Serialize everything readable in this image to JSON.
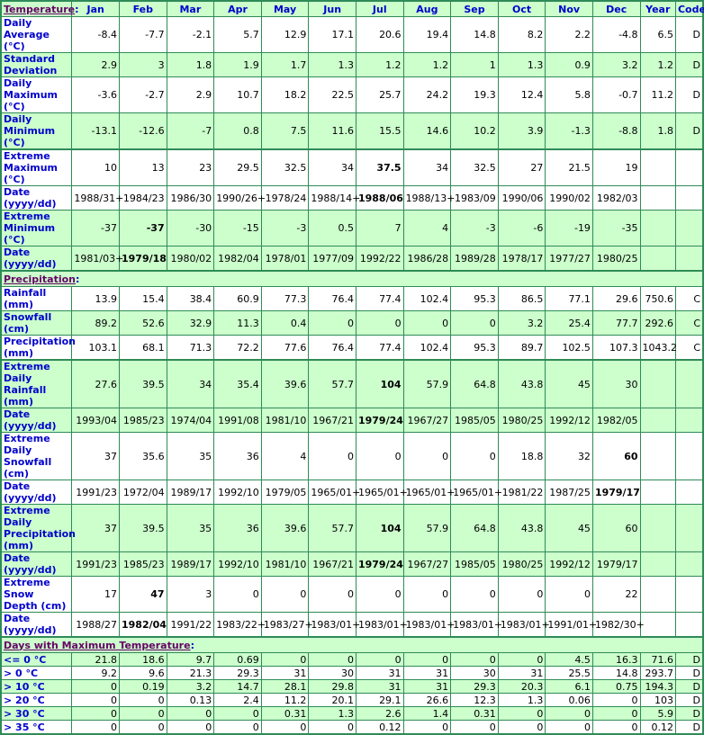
{
  "columns": [
    "Jan",
    "Feb",
    "Mar",
    "Apr",
    "May",
    "Jun",
    "Jul",
    "Aug",
    "Sep",
    "Oct",
    "Nov",
    "Dec",
    "Year",
    "Code"
  ],
  "sections": [
    {
      "title": "Temperature",
      "rows": [
        {
          "label": "Daily Average (°C)",
          "h": "h2",
          "bg": "w",
          "values": [
            "-8.4",
            "-7.7",
            "-2.1",
            "5.7",
            "12.9",
            "17.1",
            "20.6",
            "19.4",
            "14.8",
            "8.2",
            "2.2",
            "-4.8",
            "6.5",
            "D"
          ],
          "bold": []
        },
        {
          "label": "Standard Deviation",
          "h": "h2",
          "bg": "g",
          "values": [
            "2.9",
            "3",
            "1.8",
            "1.9",
            "1.7",
            "1.3",
            "1.2",
            "1.2",
            "1",
            "1.3",
            "0.9",
            "3.2",
            "1.2",
            "D"
          ],
          "bold": []
        },
        {
          "label": "Daily Maximum (°C)",
          "h": "h3",
          "bg": "w",
          "values": [
            "-3.6",
            "-2.7",
            "2.9",
            "10.7",
            "18.2",
            "22.5",
            "25.7",
            "24.2",
            "19.3",
            "12.4",
            "5.8",
            "-0.7",
            "11.2",
            "D"
          ],
          "bold": []
        },
        {
          "label": "Daily Minimum (°C)",
          "h": "h3",
          "bg": "g",
          "values": [
            "-13.1",
            "-12.6",
            "-7",
            "0.8",
            "7.5",
            "11.6",
            "15.5",
            "14.6",
            "10.2",
            "3.9",
            "-1.3",
            "-8.8",
            "1.8",
            "D"
          ],
          "bold": []
        },
        {
          "label": "Extreme Maximum (°C)",
          "h": "h3",
          "bg": "w",
          "sep": true,
          "values": [
            "10",
            "13",
            "23",
            "29.5",
            "32.5",
            "34",
            "37.5",
            "34",
            "32.5",
            "27",
            "21.5",
            "19",
            "",
            ""
          ],
          "bold": [
            6
          ]
        },
        {
          "label": "Date (yyyy/dd)",
          "h": "h2",
          "bg": "w",
          "values": [
            "1988/31+",
            "1984/23",
            "1986/30",
            "1990/26+",
            "1978/24",
            "1988/14+",
            "1988/06",
            "1988/13+",
            "1983/09",
            "1990/06",
            "1990/02",
            "1982/03",
            "",
            ""
          ],
          "bold": [
            6
          ]
        },
        {
          "label": "Extreme Minimum (°C)",
          "h": "h3",
          "bg": "g",
          "values": [
            "-37",
            "-37",
            "-30",
            "-15",
            "-3",
            "0.5",
            "7",
            "4",
            "-3",
            "-6",
            "-19",
            "-35",
            "",
            ""
          ],
          "bold": [
            1
          ]
        },
        {
          "label": "Date (yyyy/dd)",
          "h": "h2",
          "bg": "g",
          "values": [
            "1981/03+",
            "1979/18",
            "1980/02",
            "1982/04",
            "1978/01",
            "1977/09",
            "1992/22",
            "1986/28",
            "1989/28",
            "1978/17",
            "1977/27",
            "1980/25",
            "",
            ""
          ],
          "bold": [
            1
          ]
        }
      ]
    },
    {
      "title": "Precipitation",
      "rows": [
        {
          "label": "Rainfall (mm)",
          "h": "h1",
          "bg": "w",
          "values": [
            "13.9",
            "15.4",
            "38.4",
            "60.9",
            "77.3",
            "76.4",
            "77.4",
            "102.4",
            "95.3",
            "86.5",
            "77.1",
            "29.6",
            "750.6",
            "C"
          ],
          "bold": []
        },
        {
          "label": "Snowfall (cm)",
          "h": "h2",
          "bg": "g",
          "values": [
            "89.2",
            "52.6",
            "32.9",
            "11.3",
            "0.4",
            "0",
            "0",
            "0",
            "0",
            "3.2",
            "25.4",
            "77.7",
            "292.6",
            "C"
          ],
          "bold": []
        },
        {
          "label": "Precipitation (mm)",
          "h": "h2",
          "bg": "w",
          "values": [
            "103.1",
            "68.1",
            "71.3",
            "72.2",
            "77.6",
            "76.4",
            "77.4",
            "102.4",
            "95.3",
            "89.7",
            "102.5",
            "107.3",
            "1043.2",
            "C"
          ],
          "bold": []
        },
        {
          "label": "Extreme Daily Rainfall (mm)",
          "h": "h2",
          "bg": "g",
          "sep": true,
          "values": [
            "27.6",
            "39.5",
            "34",
            "35.4",
            "39.6",
            "57.7",
            "104",
            "57.9",
            "64.8",
            "43.8",
            "45",
            "30",
            "",
            ""
          ],
          "bold": [
            6
          ]
        },
        {
          "label": "Date (yyyy/dd)",
          "h": "h2",
          "bg": "g",
          "values": [
            "1993/04",
            "1985/23",
            "1974/04",
            "1991/08",
            "1981/10",
            "1967/21",
            "1979/24",
            "1967/27",
            "1985/05",
            "1980/25",
            "1992/12",
            "1982/05",
            "",
            ""
          ],
          "bold": [
            6
          ]
        },
        {
          "label": "Extreme Daily Snowfall (cm)",
          "h": "h3",
          "bg": "w",
          "values": [
            "37",
            "35.6",
            "35",
            "36",
            "4",
            "0",
            "0",
            "0",
            "0",
            "18.8",
            "32",
            "60",
            "",
            ""
          ],
          "bold": [
            11
          ]
        },
        {
          "label": "Date (yyyy/dd)",
          "h": "h2",
          "bg": "w",
          "values": [
            "1991/23",
            "1972/04",
            "1989/17",
            "1992/10",
            "1979/05",
            "1965/01+",
            "1965/01+",
            "1965/01+",
            "1965/01+",
            "1981/22",
            "1987/25",
            "1979/17",
            "",
            ""
          ],
          "bold": [
            11
          ]
        },
        {
          "label": "Extreme Daily Precipitation (mm)",
          "h": "h3",
          "bg": "g",
          "values": [
            "37",
            "39.5",
            "35",
            "36",
            "39.6",
            "57.7",
            "104",
            "57.9",
            "64.8",
            "43.8",
            "45",
            "60",
            "",
            ""
          ],
          "bold": [
            6
          ]
        },
        {
          "label": "Date (yyyy/dd)",
          "h": "h2",
          "bg": "g",
          "values": [
            "1991/23",
            "1985/23",
            "1989/17",
            "1992/10",
            "1981/10",
            "1967/21",
            "1979/24",
            "1967/27",
            "1985/05",
            "1980/25",
            "1992/12",
            "1979/17",
            "",
            ""
          ],
          "bold": [
            6
          ]
        },
        {
          "label": "Extreme Snow Depth (cm)",
          "h": "h3",
          "bg": "w",
          "values": [
            "17",
            "47",
            "3",
            "0",
            "0",
            "0",
            "0",
            "0",
            "0",
            "0",
            "0",
            "22",
            "",
            ""
          ],
          "bold": [
            1
          ]
        },
        {
          "label": "Date (yyyy/dd)",
          "h": "h2",
          "bg": "w",
          "values": [
            "1988/27",
            "1982/04",
            "1991/22",
            "1983/22+",
            "1983/27+",
            "1983/01+",
            "1983/01+",
            "1983/01+",
            "1983/01+",
            "1983/01+",
            "1991/01+",
            "1982/30+",
            "",
            ""
          ],
          "bold": [
            1
          ]
        }
      ]
    },
    {
      "title": "Days with Maximum Temperature",
      "rows": [
        {
          "label": "<= 0 °C",
          "h": "h1",
          "bg": "g",
          "values": [
            "21.8",
            "18.6",
            "9.7",
            "0.69",
            "0",
            "0",
            "0",
            "0",
            "0",
            "0",
            "4.5",
            "16.3",
            "71.6",
            "D"
          ],
          "bold": []
        },
        {
          "label": "> 0 °C",
          "h": "h1",
          "bg": "w",
          "values": [
            "9.2",
            "9.6",
            "21.3",
            "29.3",
            "31",
            "30",
            "31",
            "31",
            "30",
            "31",
            "25.5",
            "14.8",
            "293.7",
            "D"
          ],
          "bold": []
        },
        {
          "label": "> 10 °C",
          "h": "h1",
          "bg": "g",
          "values": [
            "0",
            "0.19",
            "3.2",
            "14.7",
            "28.1",
            "29.8",
            "31",
            "31",
            "29.3",
            "20.3",
            "6.1",
            "0.75",
            "194.3",
            "D"
          ],
          "bold": []
        },
        {
          "label": "> 20 °C",
          "h": "h1",
          "bg": "w",
          "values": [
            "0",
            "0",
            "0.13",
            "2.4",
            "11.2",
            "20.1",
            "29.1",
            "26.6",
            "12.3",
            "1.3",
            "0.06",
            "0",
            "103",
            "D"
          ],
          "bold": []
        },
        {
          "label": "> 30 °C",
          "h": "h1",
          "bg": "g",
          "values": [
            "0",
            "0",
            "0",
            "0",
            "0.31",
            "1.3",
            "2.6",
            "1.4",
            "0.31",
            "0",
            "0",
            "0",
            "5.9",
            "D"
          ],
          "bold": []
        },
        {
          "label": "> 35 °C",
          "h": "h1",
          "bg": "w",
          "values": [
            "0",
            "0",
            "0",
            "0",
            "0",
            "0",
            "0.12",
            "0",
            "0",
            "0",
            "0",
            "0",
            "0.12",
            "D"
          ],
          "bold": []
        }
      ]
    }
  ]
}
